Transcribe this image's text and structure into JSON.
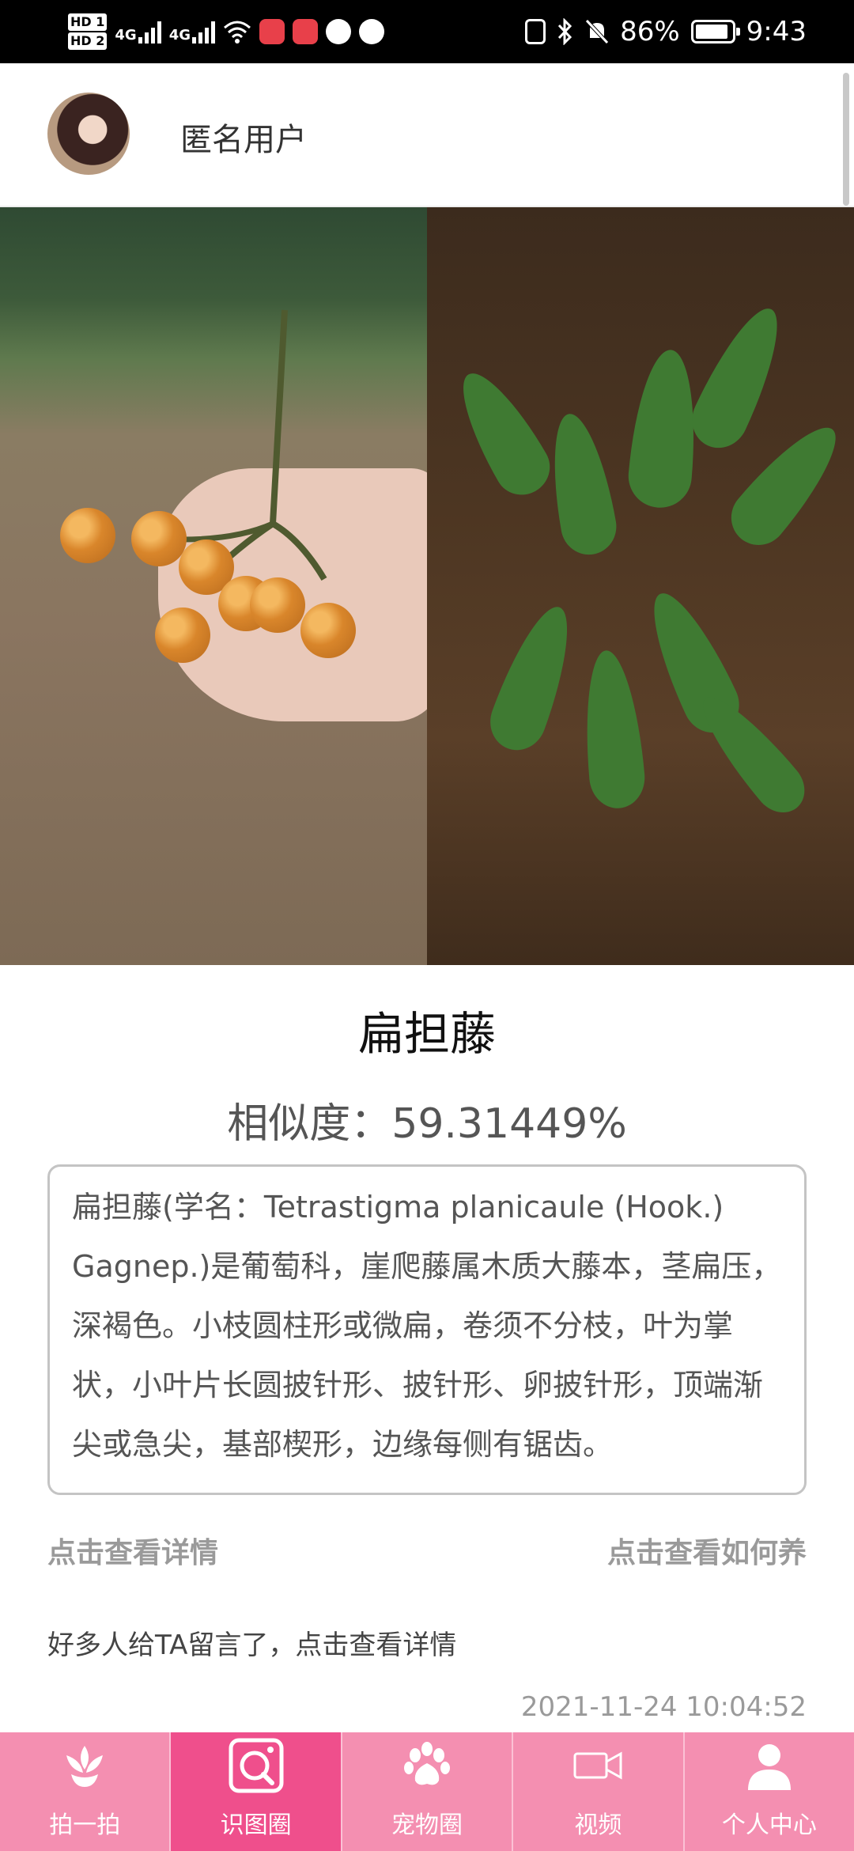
{
  "status_bar": {
    "hd_top": "HD 1",
    "hd_bottom": "HD 2",
    "net1": "4G",
    "net2": "4G",
    "battery_percent": "86%",
    "time": "9:43"
  },
  "header": {
    "username": "匿名用户"
  },
  "result": {
    "plant_name": "扁担藤",
    "similarity": "相似度：59.31449%",
    "description": "扁担藤(学名：Tetrastigma planicaule (Hook.) Gagnep.)是葡萄科，崖爬藤属木质大藤本，茎扁压，深褐色。小枝圆柱形或微扁，卷须不分枝，叶为掌状，小叶片长圆披针形、披针形、卵披针形，顶端渐尖或急尖，基部楔形，边缘每侧有锯齿。",
    "view_detail_link": "点击查看详情",
    "how_to_grow_link": "点击查看如何养",
    "comment_hint": "好多人给TA留言了，点击查看详情",
    "timestamp": "2021-11-24 10:04:52"
  },
  "bottom_nav": {
    "items": [
      {
        "label": "拍一拍",
        "icon": "flower-icon"
      },
      {
        "label": "识图圈",
        "icon": "photo-search-icon",
        "active": true
      },
      {
        "label": "宠物圈",
        "icon": "paw-icon"
      },
      {
        "label": "视频",
        "icon": "video-camera-icon"
      },
      {
        "label": "个人中心",
        "icon": "person-icon"
      }
    ],
    "colors": {
      "background": "#f48fb1",
      "active": "#ef4f8c"
    }
  }
}
